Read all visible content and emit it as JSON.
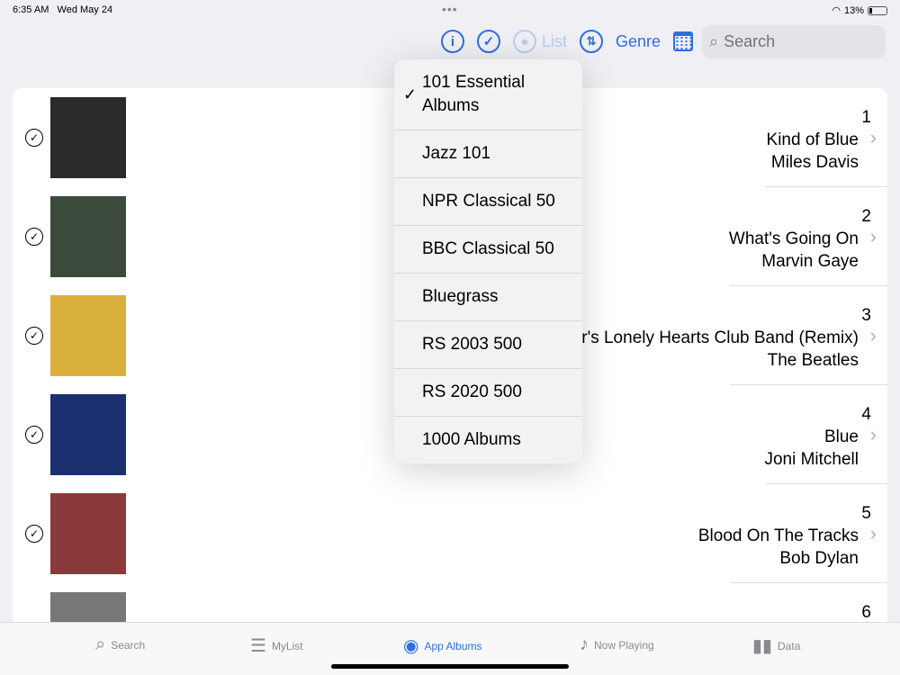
{
  "status": {
    "time": "6:35 AM",
    "date": "Wed May 24",
    "battery": "13%",
    "battery_level": 0.13
  },
  "toolbar": {
    "info_icon": "info-circle-icon",
    "select_icon": "checkmark-circle-icon",
    "list_label": "List",
    "sort_icon": "sort-arrows-icon",
    "genre_label": "Genre",
    "calendar_icon": "calendar-icon",
    "search_placeholder": "Search"
  },
  "albums": [
    {
      "rank": "1",
      "title": "Kind of Blue",
      "artist": "Miles Davis",
      "art_color": "#2a2a2a"
    },
    {
      "rank": "2",
      "title": "What's Going On",
      "artist": "Marvin Gaye",
      "art_color": "#3b4a3a"
    },
    {
      "rank": "3",
      "title": "er's Lonely Hearts Club Band (Remix)",
      "artist": "The Beatles",
      "art_color": "#d9b13a"
    },
    {
      "rank": "4",
      "title": "Blue",
      "artist": "Joni Mitchell",
      "art_color": "#1c3070"
    },
    {
      "rank": "5",
      "title": "Blood On The Tracks",
      "artist": "Bob Dylan",
      "art_color": "#8a3a3a"
    },
    {
      "rank": "6",
      "title": "",
      "artist": "",
      "art_color": "#777777"
    }
  ],
  "menu": {
    "selected": "101 Essential Albums",
    "items": [
      "101 Essential Albums",
      "Jazz 101",
      "NPR Classical 50",
      "BBC Classical 50",
      "Bluegrass",
      "RS 2003 500",
      "RS 2020 500",
      "1000 Albums"
    ]
  },
  "tabs": [
    {
      "label": "Search",
      "icon": "magnifier-icon"
    },
    {
      "label": "MyList",
      "icon": "list-icon"
    },
    {
      "label": "App Albums",
      "icon": "record-icon",
      "active": true
    },
    {
      "label": "Now Playing",
      "icon": "music-note-icon"
    },
    {
      "label": "Data",
      "icon": "bar-chart-icon"
    }
  ],
  "colors": {
    "accent": "#2f6fe0"
  }
}
